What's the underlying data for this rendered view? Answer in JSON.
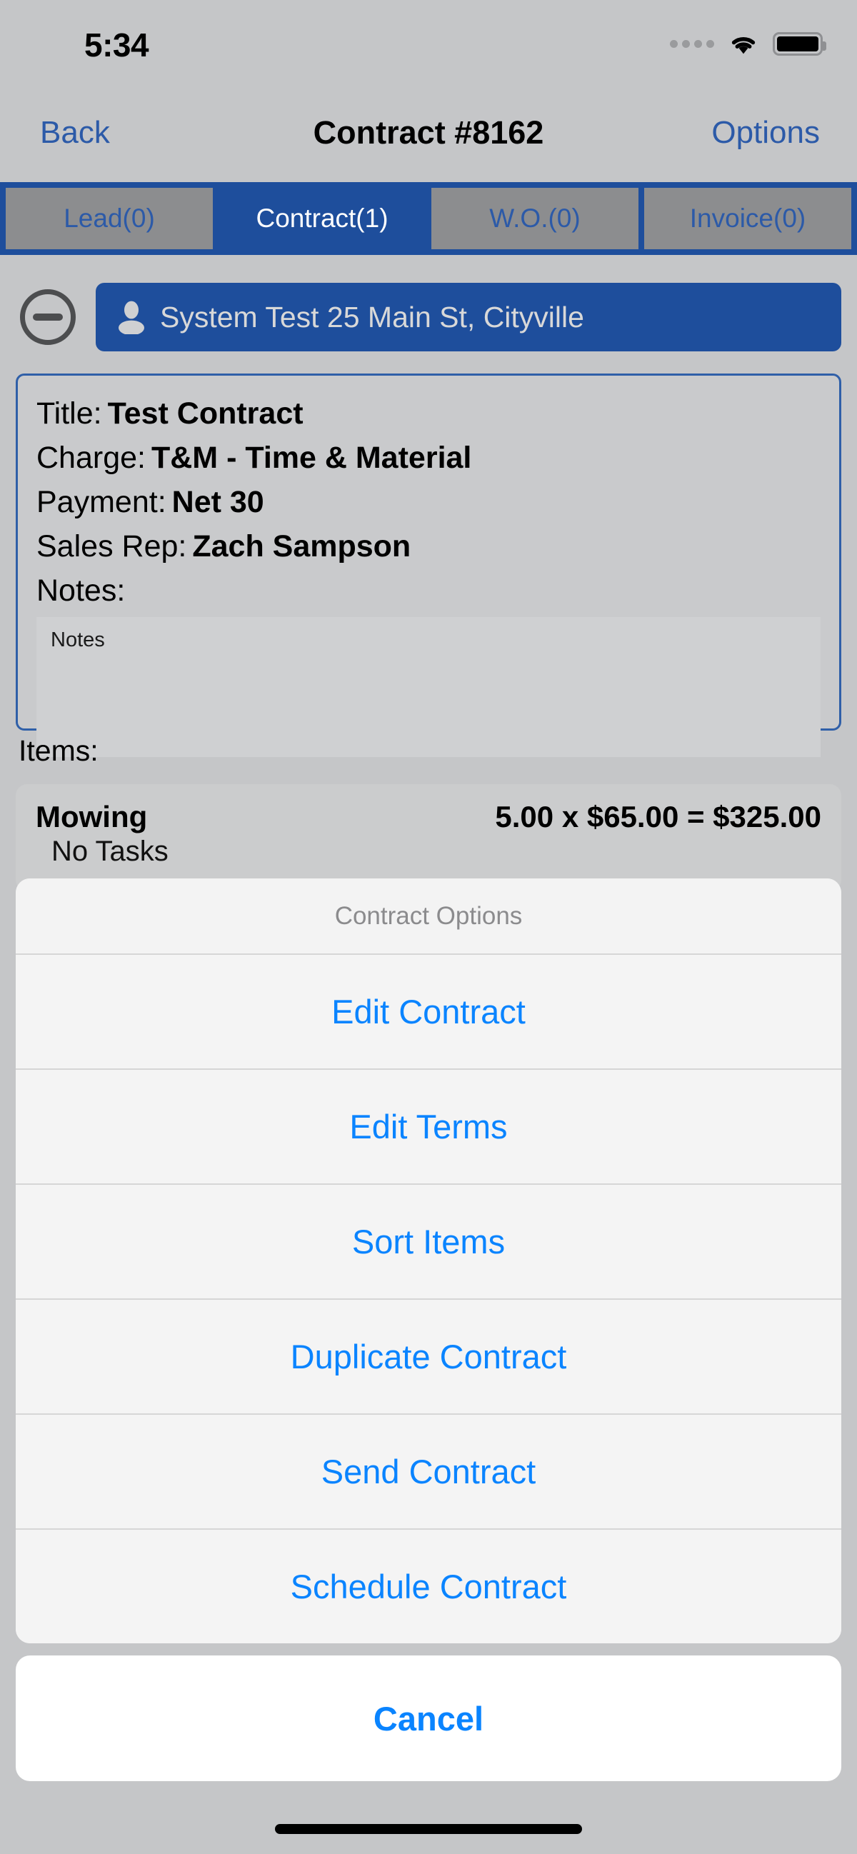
{
  "status_bar": {
    "time": "5:34",
    "signal_icon": "signal-dots-icon",
    "wifi_icon": "wifi-icon",
    "battery_icon": "battery-full-icon"
  },
  "nav": {
    "back_label": "Back",
    "title": "Contract #8162",
    "options_label": "Options"
  },
  "tabs": [
    {
      "label": "Lead(0)",
      "active": false
    },
    {
      "label": "Contract(1)",
      "active": true
    },
    {
      "label": "W.O.(0)",
      "active": false
    },
    {
      "label": "Invoice(0)",
      "active": false
    }
  ],
  "customer": {
    "collapse_icon": "minus-circle-icon",
    "person_icon": "person-icon",
    "name": "System Test 25 Main St, Cityville"
  },
  "details": {
    "title_label": "Title:",
    "title_value": "Test Contract",
    "charge_label": "Charge:",
    "charge_value": "T&M - Time & Material",
    "payment_label": "Payment:",
    "payment_value": "Net 30",
    "sales_rep_label": "Sales Rep:",
    "sales_rep_value": "Zach Sampson",
    "notes_label": "Notes:",
    "notes_value": "Notes"
  },
  "items": {
    "section_label": "Items:",
    "rows": [
      {
        "name": "Mowing",
        "price": "5.00 x $65.00 = $325.00",
        "sub": "No Tasks"
      }
    ]
  },
  "action_sheet": {
    "title": "Contract Options",
    "options": [
      "Edit Contract",
      "Edit Terms",
      "Sort Items",
      "Duplicate Contract",
      "Send Contract",
      "Schedule Contract"
    ],
    "cancel_label": "Cancel"
  },
  "colors": {
    "accent_blue": "#0a84ff",
    "brand_blue": "#1e4e9c",
    "nav_link": "#2c5aa8",
    "page_bg": "#c5c6c8",
    "tab_inactive": "#8c8d8f"
  }
}
